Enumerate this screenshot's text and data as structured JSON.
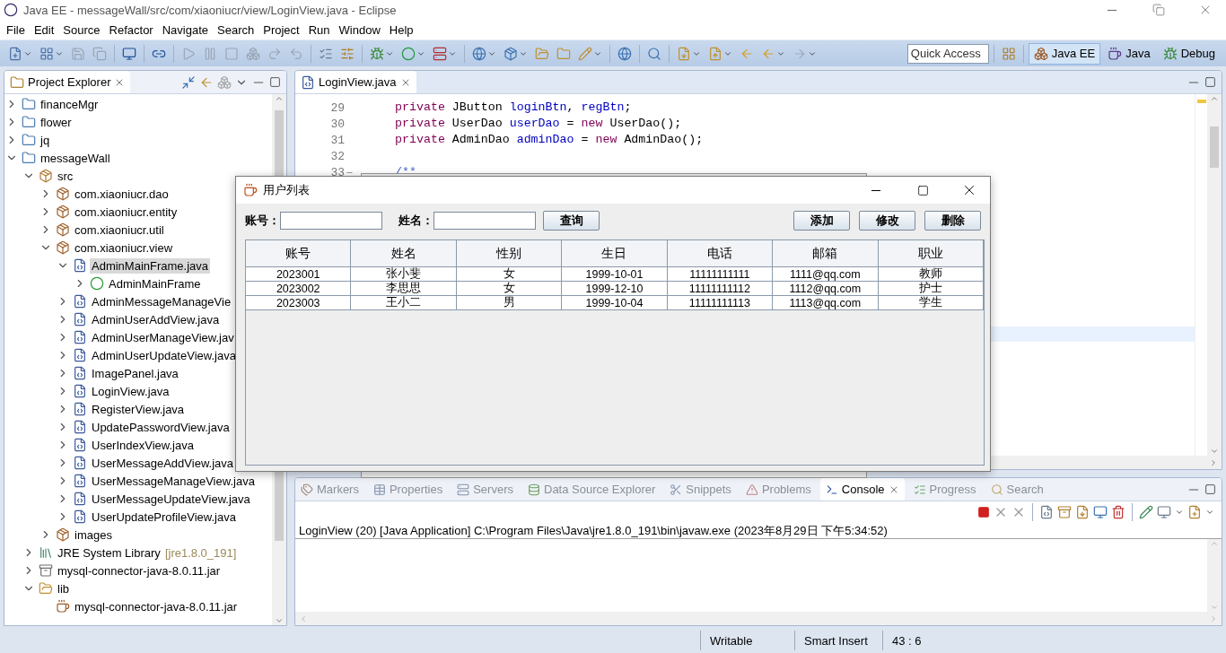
{
  "window": {
    "title": "Java EE - messageWall/src/com/xiaoniucr/view/LoginView.java - Eclipse"
  },
  "menu": [
    "File",
    "Edit",
    "Source",
    "Refactor",
    "Navigate",
    "Search",
    "Project",
    "Run",
    "Window",
    "Help"
  ],
  "toolbar": {
    "quick_access": {
      "placeholder": "Quick Access"
    },
    "perspectives": [
      {
        "label": "Java EE",
        "selected": true
      },
      {
        "label": "Java",
        "selected": false
      },
      {
        "label": "Debug",
        "selected": false
      }
    ]
  },
  "project_explorer": {
    "title": "Project Explorer",
    "tree": [
      {
        "kind": "project",
        "label": "financeMgr",
        "expanded": false,
        "selected": false
      },
      {
        "kind": "project",
        "label": "flower",
        "expanded": false,
        "selected": false
      },
      {
        "kind": "project",
        "label": "jq",
        "expanded": false,
        "selected": false
      },
      {
        "kind": "project",
        "label": "messageWall",
        "expanded": true,
        "selected": false,
        "children": [
          {
            "kind": "source",
            "label": "src",
            "expanded": true,
            "selected": false,
            "children": [
              {
                "kind": "package",
                "label": "com.xiaoniucr.dao",
                "expanded": false,
                "selected": false
              },
              {
                "kind": "package",
                "label": "com.xiaoniucr.entity",
                "expanded": false,
                "selected": false
              },
              {
                "kind": "package",
                "label": "com.xiaoniucr.util",
                "expanded": false,
                "selected": false
              },
              {
                "kind": "package",
                "label": "com.xiaoniucr.view",
                "expanded": true,
                "selected": false,
                "children": [
                  {
                    "kind": "java",
                    "label": "AdminMainFrame.java",
                    "expanded": true,
                    "selected": true,
                    "children": [
                      {
                        "kind": "class",
                        "label": "AdminMainFrame",
                        "expanded": false,
                        "selected": false
                      }
                    ]
                  },
                  {
                    "kind": "java",
                    "label": "AdminMessageManageVie",
                    "expanded": false,
                    "selected": false
                  },
                  {
                    "kind": "java",
                    "label": "AdminUserAddView.java",
                    "expanded": false,
                    "selected": false
                  },
                  {
                    "kind": "java",
                    "label": "AdminUserManageView.jav",
                    "expanded": false,
                    "selected": false
                  },
                  {
                    "kind": "java",
                    "label": "AdminUserUpdateView.java",
                    "expanded": false,
                    "selected": false
                  },
                  {
                    "kind": "java",
                    "label": "ImagePanel.java",
                    "expanded": false,
                    "selected": false
                  },
                  {
                    "kind": "java",
                    "label": "LoginView.java",
                    "expanded": false,
                    "selected": false
                  },
                  {
                    "kind": "java",
                    "label": "RegisterView.java",
                    "expanded": false,
                    "selected": false
                  },
                  {
                    "kind": "java",
                    "label": "UpdatePasswordView.java",
                    "expanded": false,
                    "selected": false
                  },
                  {
                    "kind": "java",
                    "label": "UserIndexView.java",
                    "expanded": false,
                    "selected": false
                  },
                  {
                    "kind": "java",
                    "label": "UserMessageAddView.java",
                    "expanded": false,
                    "selected": false
                  },
                  {
                    "kind": "java",
                    "label": "UserMessageManageView.java",
                    "expanded": false,
                    "selected": false
                  },
                  {
                    "kind": "java",
                    "label": "UserMessageUpdateView.java",
                    "expanded": false,
                    "selected": false
                  },
                  {
                    "kind": "java",
                    "label": "UserUpdateProfileView.java",
                    "expanded": false,
                    "selected": false
                  }
                ]
              },
              {
                "kind": "package",
                "label": "images",
                "expanded": false,
                "selected": false
              }
            ]
          },
          {
            "kind": "library",
            "label": "JRE System Library",
            "decoration": "[jre1.8.0_191]",
            "expanded": false,
            "selected": false
          },
          {
            "kind": "jar",
            "label": "mysql-connector-java-8.0.11.jar",
            "expanded": false,
            "selected": false
          },
          {
            "kind": "folder",
            "label": "lib",
            "expanded": true,
            "selected": false,
            "children": [
              {
                "kind": "jarfile",
                "label": "mysql-connector-java-8.0.11.jar",
                "selected": false
              }
            ]
          }
        ]
      }
    ]
  },
  "editor": {
    "tab": {
      "title": "LoginView.java"
    },
    "lines": [
      {
        "number": "29",
        "foldable": false,
        "tokens": [
          {
            "kind": "keyword",
            "text": "private"
          },
          {
            "kind": "plain",
            "text": " JButton "
          },
          {
            "kind": "field",
            "text": "loginBtn"
          },
          {
            "kind": "plain",
            "text": ", "
          },
          {
            "kind": "field",
            "text": "regBtn"
          },
          {
            "kind": "plain",
            "text": ";"
          }
        ]
      },
      {
        "number": "30",
        "foldable": false,
        "tokens": [
          {
            "kind": "keyword",
            "text": "private"
          },
          {
            "kind": "plain",
            "text": " UserDao "
          },
          {
            "kind": "field",
            "text": "userDao"
          },
          {
            "kind": "plain",
            "text": " = "
          },
          {
            "kind": "keyword",
            "text": "new"
          },
          {
            "kind": "plain",
            "text": " UserDao();"
          }
        ]
      },
      {
        "number": "31",
        "foldable": false,
        "tokens": [
          {
            "kind": "keyword",
            "text": "private"
          },
          {
            "kind": "plain",
            "text": " AdminDao "
          },
          {
            "kind": "field",
            "text": "adminDao"
          },
          {
            "kind": "plain",
            "text": " = "
          },
          {
            "kind": "keyword",
            "text": "new"
          },
          {
            "kind": "plain",
            "text": " AdminDao();"
          }
        ]
      },
      {
        "number": "32",
        "foldable": false
      },
      {
        "number": "33",
        "foldable": true,
        "tokens": [
          {
            "kind": "comment",
            "text": "/**"
          }
        ]
      }
    ]
  },
  "dialog": {
    "title": "用户列表",
    "search": [
      {
        "label": "账号："
      },
      {
        "label": "姓名："
      }
    ],
    "buttons": [
      "查询",
      "添加",
      "修改",
      "删除"
    ],
    "table": {
      "columns": [
        "账号",
        "姓名",
        "性别",
        "生日",
        "电话",
        "邮箱",
        "职业"
      ],
      "rows": [
        [
          "2023001",
          "张小斐",
          "女",
          "1999-10-01",
          "11111111111",
          "1111@qq.com",
          "教师"
        ],
        [
          "2023002",
          "李思思",
          "女",
          "1999-12-10",
          "11111111112",
          "1112@qq.com",
          "护士"
        ],
        [
          "2023003",
          "王小二",
          "男",
          "1999-10-04",
          "11111111113",
          "1113@qq.com",
          "学生"
        ]
      ]
    }
  },
  "bottom_panel": {
    "tabs": [
      {
        "kind": "markers",
        "label": "Markers",
        "selected": false
      },
      {
        "kind": "properties",
        "label": "Properties",
        "selected": false
      },
      {
        "kind": "servers",
        "label": "Servers",
        "selected": false
      },
      {
        "kind": "datasource",
        "label": "Data Source Explorer",
        "selected": false
      },
      {
        "kind": "snippets",
        "label": "Snippets",
        "selected": false
      },
      {
        "kind": "problems",
        "label": "Problems",
        "selected": false
      },
      {
        "kind": "console",
        "label": "Console",
        "selected": true
      },
      {
        "kind": "progress",
        "label": "Progress",
        "selected": false
      },
      {
        "kind": "search",
        "label": "Search",
        "selected": false
      }
    ],
    "console_header": "LoginView (20) [Java Application] C:\\Program Files\\Java\\jre1.8.0_191\\bin\\javaw.exe (2023年8月29日 下午5:34:52)"
  },
  "status_bar": [
    "Writable",
    "Smart Insert",
    "43 : 6"
  ]
}
